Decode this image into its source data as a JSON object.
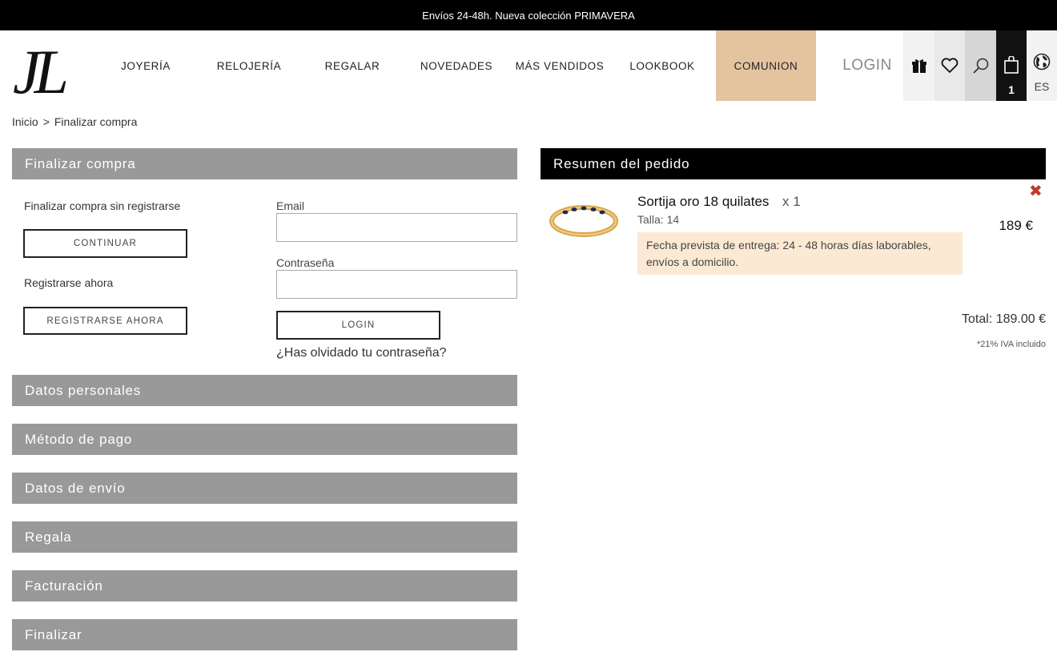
{
  "topbar": {
    "text": "Envíos 24-48h. Nueva colección  PRIMAVERA"
  },
  "logo": {
    "text": "JL"
  },
  "nav": {
    "items": [
      "JOYERÍA",
      "RELOJERÍA",
      "REGALAR",
      "NOVEDADES",
      "MÁS VENDIDOS",
      "LOOKBOOK",
      "COMUNION"
    ],
    "login": "LOGIN",
    "cart_count": "1",
    "language": "ES",
    "highlight_color": "#e4c39f"
  },
  "icons": [
    "gift-icon",
    "heart-icon",
    "search-icon",
    "cart-icon",
    "globe-icon",
    "close-icon"
  ],
  "breadcrumb": {
    "home": "Inicio",
    "separator": ">",
    "current": "Finalizar compra"
  },
  "checkout": {
    "title": "Finalizar compra",
    "guest_label": "Finalizar compra sin registrarse",
    "continue_button": "CONTINUAR",
    "register_label": "Registrarse ahora",
    "register_button": "REGISTRARSE AHORA",
    "email_label": "Email",
    "email_value": "",
    "password_label": "Contraseña",
    "password_value": "",
    "login_button": "LOGIN",
    "forgot_link": "¿Has olvidado tu contraseña?"
  },
  "sections": [
    "Datos personales",
    "Método de pago",
    "Datos de envío",
    "Regala",
    "Facturación",
    "Finalizar"
  ],
  "summary": {
    "title": "Resumen del pedido",
    "product_name": "Sortija oro 18 quilates",
    "quantity": "x 1",
    "size": "Talla: 14",
    "delivery": "Fecha prevista de entrega: 24 - 48 horas días laborables, envíos a domicilio.",
    "price": "189 €",
    "total": "Total: 189.00 €",
    "tax_note": "*21% IVA incluido"
  }
}
